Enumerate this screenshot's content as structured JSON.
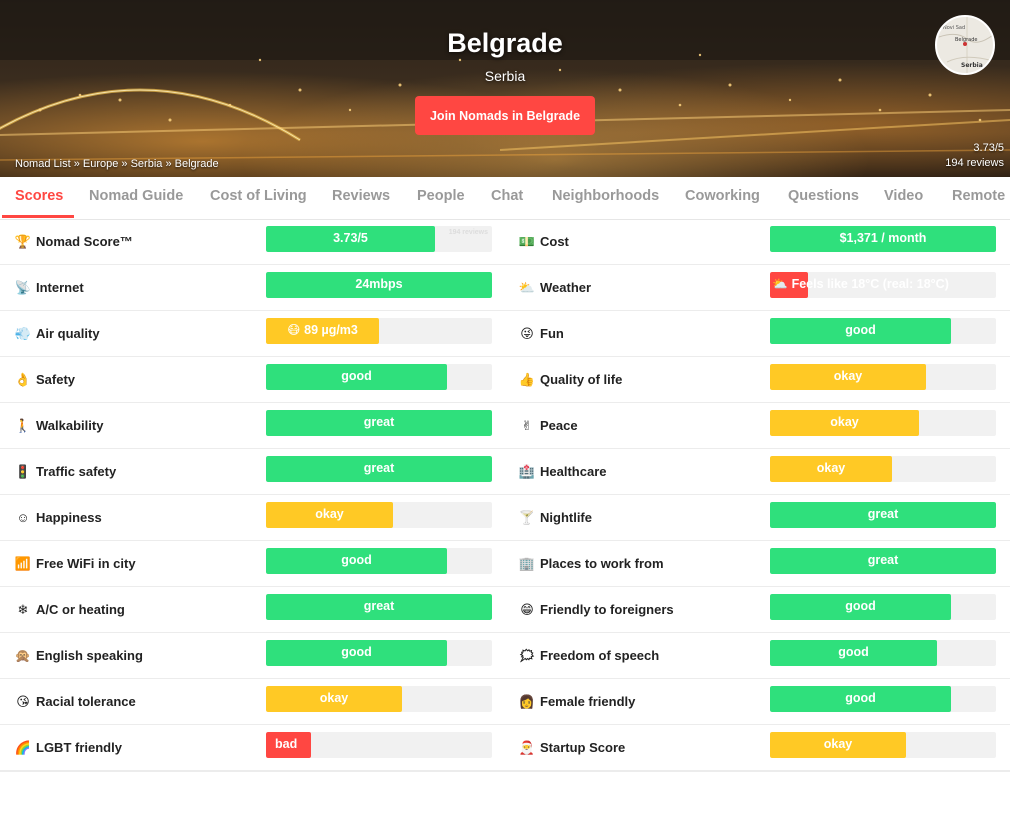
{
  "hero": {
    "city": "Belgrade",
    "country": "Serbia",
    "join_button": "Join Nomads in Belgrade",
    "breadcrumbs": [
      "Nomad List",
      "Europe",
      "Serbia",
      "Belgrade"
    ],
    "rating": "3.73/5",
    "reviews": "194 reviews",
    "map_labels": [
      "Novi Sad",
      "Belgrade",
      "Serbia"
    ]
  },
  "tabs": [
    {
      "label": "Scores",
      "active": true
    },
    {
      "label": "Nomad Guide"
    },
    {
      "label": "Cost of Living"
    },
    {
      "label": "Reviews"
    },
    {
      "label": "People"
    },
    {
      "label": "Chat"
    },
    {
      "label": "Neighborhoods"
    },
    {
      "label": "Coworking"
    },
    {
      "label": "Questions"
    },
    {
      "label": "Video"
    },
    {
      "label": "Remote"
    }
  ],
  "scores": [
    {
      "left": {
        "label": "Nomad Score™",
        "icon": "trophy-icon",
        "glyph": "🏆",
        "value": "3.73/5",
        "fill": 0.746,
        "color": "green",
        "sub": "194 reviews"
      },
      "right": {
        "label": "Cost",
        "icon": "money-icon",
        "glyph": "💵",
        "value": "$1,371 / month",
        "fill": 1.0,
        "color": "green"
      }
    },
    {
      "left": {
        "label": "Internet",
        "icon": "satellite-dish-icon",
        "glyph": "📡",
        "value": "24mbps",
        "fill": 1.0,
        "color": "green"
      },
      "right": {
        "label": "Weather",
        "icon": "sun-behind-cloud-icon",
        "glyph": "⛅",
        "value": "Feels like 18°C (real: 18°C)",
        "fill": 0.17,
        "color": "red",
        "prefix": "⛅"
      }
    },
    {
      "left": {
        "label": "Air quality",
        "icon": "wind-icon",
        "glyph": "💨",
        "value": "89 µg/m3",
        "fill": 0.5,
        "color": "yellow",
        "prefix": "😷"
      },
      "right": {
        "label": "Fun",
        "icon": "grinning-face-icon",
        "glyph": "😜",
        "value": "good",
        "fill": 0.8,
        "color": "green"
      }
    },
    {
      "left": {
        "label": "Safety",
        "icon": "ok-hand-icon",
        "glyph": "👌",
        "value": "good",
        "fill": 0.8,
        "color": "green"
      },
      "right": {
        "label": "Quality of life",
        "icon": "thumbs-up-icon",
        "glyph": "👍",
        "value": "okay",
        "fill": 0.69,
        "color": "yellow"
      }
    },
    {
      "left": {
        "label": "Walkability",
        "icon": "walking-person-icon",
        "glyph": "🚶",
        "value": "great",
        "fill": 1.0,
        "color": "green"
      },
      "right": {
        "label": "Peace",
        "icon": "peace-hand-icon",
        "glyph": "✌",
        "value": "okay",
        "fill": 0.66,
        "color": "yellow"
      }
    },
    {
      "left": {
        "label": "Traffic safety",
        "icon": "traffic-light-icon",
        "glyph": "🚦",
        "value": "great",
        "fill": 1.0,
        "color": "green"
      },
      "right": {
        "label": "Healthcare",
        "icon": "hospital-icon",
        "glyph": "🏥",
        "value": "okay",
        "fill": 0.54,
        "color": "yellow"
      }
    },
    {
      "left": {
        "label": "Happiness",
        "icon": "smiling-face-icon",
        "glyph": "☺",
        "value": "okay",
        "fill": 0.56,
        "color": "yellow"
      },
      "right": {
        "label": "Nightlife",
        "icon": "cocktail-icon",
        "glyph": "🍸",
        "value": "great",
        "fill": 1.0,
        "color": "green"
      }
    },
    {
      "left": {
        "label": "Free WiFi in city",
        "icon": "signal-bars-icon",
        "glyph": "📶",
        "value": "good",
        "fill": 0.8,
        "color": "green"
      },
      "right": {
        "label": "Places to work from",
        "icon": "building-icon",
        "glyph": "🏢",
        "value": "great",
        "fill": 1.0,
        "color": "green"
      }
    },
    {
      "left": {
        "label": "A/C or heating",
        "icon": "snowflake-icon",
        "glyph": "❄",
        "value": "great",
        "fill": 1.0,
        "color": "green"
      },
      "right": {
        "label": "Friendly to foreigners",
        "icon": "smiley-icon",
        "glyph": "😁",
        "value": "good",
        "fill": 0.8,
        "color": "green"
      }
    },
    {
      "left": {
        "label": "English speaking",
        "icon": "monkey-face-icon",
        "glyph": "🙊",
        "value": "good",
        "fill": 0.8,
        "color": "green"
      },
      "right": {
        "label": "Freedom of speech",
        "icon": "speech-balloon-icon",
        "glyph": "🗯",
        "value": "good",
        "fill": 0.74,
        "color": "green"
      }
    },
    {
      "left": {
        "label": "Racial tolerance",
        "icon": "face-blowing-kiss-icon",
        "glyph": "😘",
        "value": "okay",
        "fill": 0.6,
        "color": "yellow"
      },
      "right": {
        "label": "Female friendly",
        "icon": "woman-icon",
        "glyph": "👩",
        "value": "good",
        "fill": 0.8,
        "color": "green"
      }
    },
    {
      "left": {
        "label": "LGBT friendly",
        "icon": "rainbow-icon",
        "glyph": "🌈",
        "value": "bad",
        "fill": 0.2,
        "color": "red",
        "align": "left"
      },
      "right": {
        "label": "Startup Score",
        "icon": "santa-icon",
        "glyph": "🎅",
        "value": "okay",
        "fill": 0.6,
        "color": "yellow"
      }
    }
  ]
}
